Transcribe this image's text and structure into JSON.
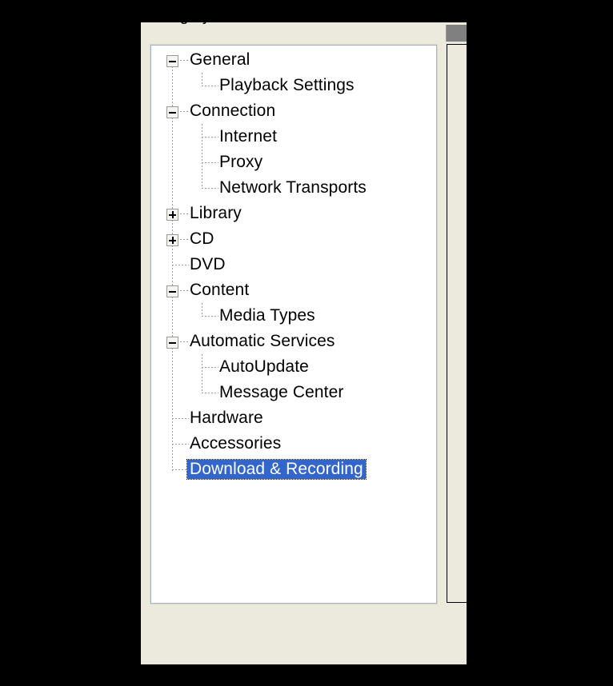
{
  "window": {
    "background_color": "#000000"
  },
  "dialog": {
    "name": "preferences-dialog",
    "background_color": "#ece9dd",
    "group_label": "Category"
  },
  "scrollbar": {
    "thumb_color": "#808080"
  },
  "tree": {
    "background_color": "#ffffff",
    "selection_color": "#3366cc",
    "selection_text_color": "#ffffff",
    "text_color": "#000000",
    "items": [
      {
        "label": "General",
        "depth": 0,
        "expander": "minus",
        "selected": false
      },
      {
        "label": "Playback Settings",
        "depth": 1,
        "expander": "none",
        "selected": false
      },
      {
        "label": "Connection",
        "depth": 0,
        "expander": "minus",
        "selected": false
      },
      {
        "label": "Internet",
        "depth": 1,
        "expander": "none",
        "selected": false
      },
      {
        "label": "Proxy",
        "depth": 1,
        "expander": "none",
        "selected": false
      },
      {
        "label": "Network Transports",
        "depth": 1,
        "expander": "none",
        "selected": false
      },
      {
        "label": "Library",
        "depth": 0,
        "expander": "plus",
        "selected": false
      },
      {
        "label": "CD",
        "depth": 0,
        "expander": "plus",
        "selected": false
      },
      {
        "label": "DVD",
        "depth": 0,
        "expander": "none",
        "selected": false
      },
      {
        "label": "Content",
        "depth": 0,
        "expander": "minus",
        "selected": false
      },
      {
        "label": "Media Types",
        "depth": 1,
        "expander": "none",
        "selected": false
      },
      {
        "label": "Automatic Services",
        "depth": 0,
        "expander": "minus",
        "selected": false
      },
      {
        "label": "AutoUpdate",
        "depth": 1,
        "expander": "none",
        "selected": false
      },
      {
        "label": "Message Center",
        "depth": 1,
        "expander": "none",
        "selected": false
      },
      {
        "label": "Hardware",
        "depth": 0,
        "expander": "none",
        "selected": false
      },
      {
        "label": "Accessories",
        "depth": 0,
        "expander": "none",
        "selected": false
      },
      {
        "label": "Download & Recording",
        "depth": 0,
        "expander": "none",
        "selected": true
      }
    ]
  }
}
